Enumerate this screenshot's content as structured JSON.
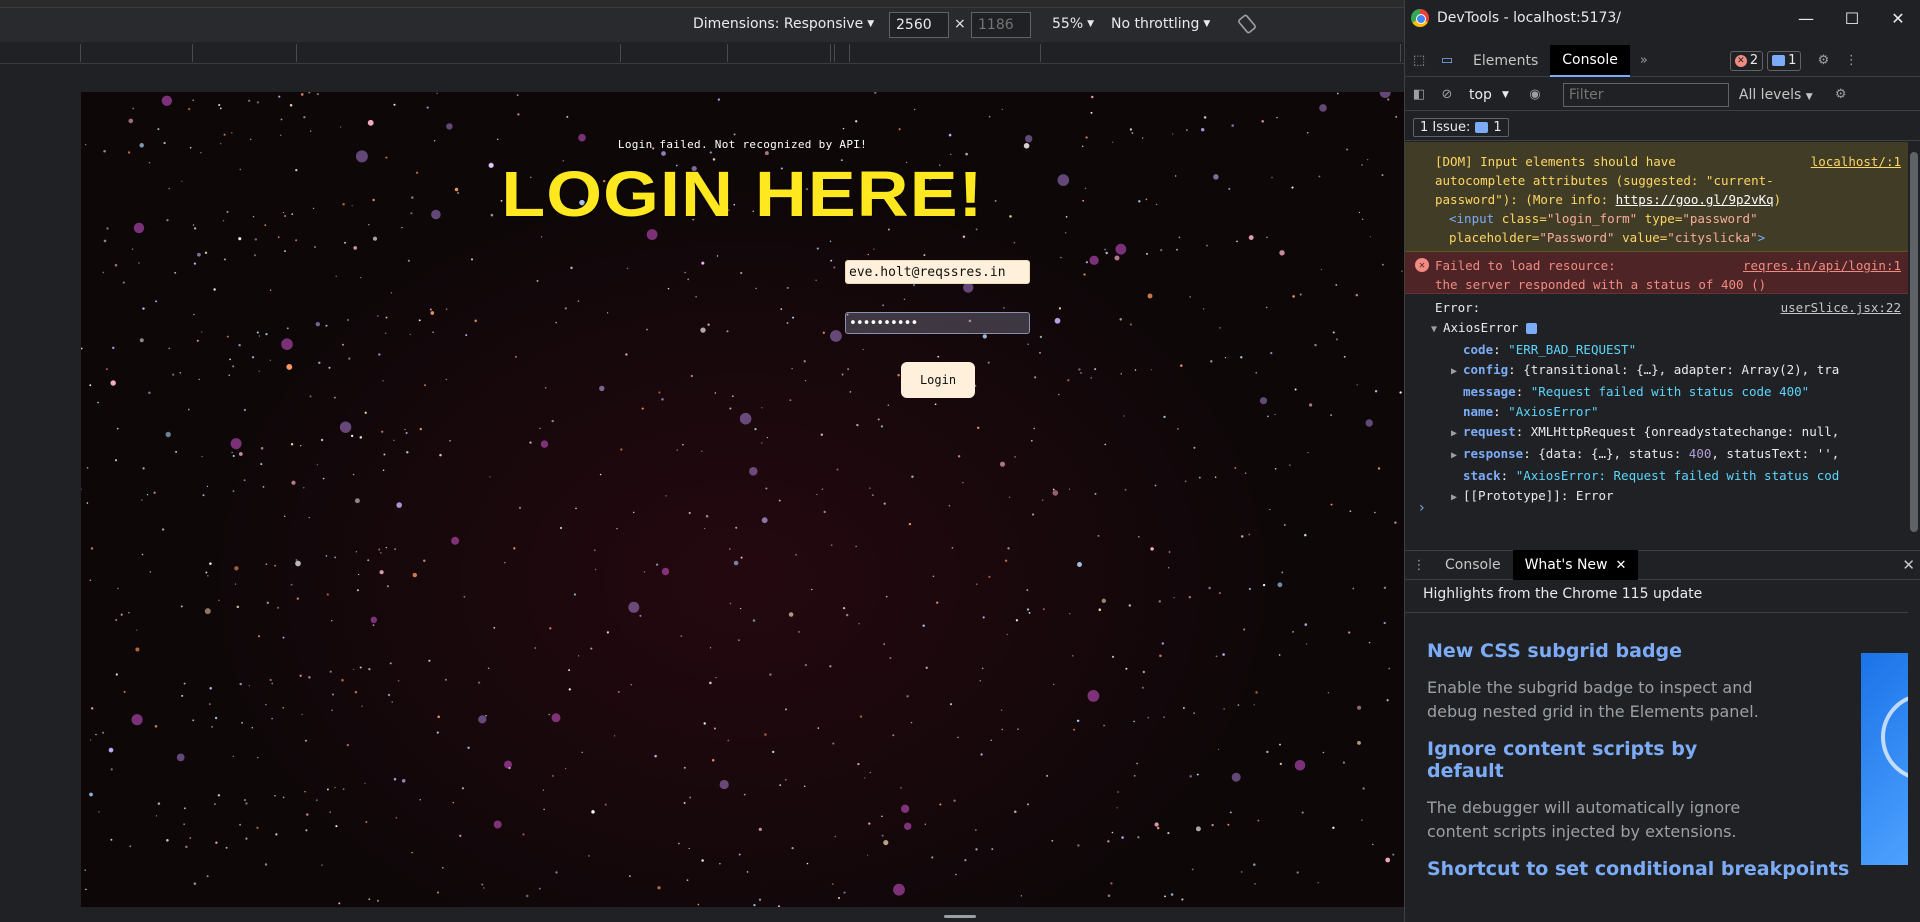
{
  "toolbar": {
    "dimensions_label": "Dimensions: Responsive",
    "width_value": "2560",
    "height_placeholder": "1186",
    "times": "×",
    "zoom": "55%",
    "throttling": "No throttling"
  },
  "page": {
    "fail_message": "Login failed. Not recognized by API!",
    "title": "LOGIN HERE!",
    "email_value": "eve.holt@reqssres.in",
    "password_value": "cityslicka",
    "login_button": "Login"
  },
  "devtools": {
    "window_title": "DevTools - localhost:5173/",
    "tabs": [
      "Elements",
      "Console"
    ],
    "error_count": "2",
    "message_count": "1",
    "context": "top",
    "filter_placeholder": "Filter",
    "levels": "All levels",
    "issues_label": "1 Issue:",
    "issues_count": "1",
    "warning": {
      "text1": "[DOM] Input elements should have",
      "text2": "autocomplete attributes (suggested: \"current-",
      "text3": "password\"): (More info: ",
      "link": "https://goo.gl/9p2vKq",
      "text3_end": ")",
      "code_tag_open": "<input",
      "code_class_attr": "class",
      "code_class_val": "\"login_form\"",
      "code_type_attr": "type",
      "code_type_val": "\"password\"",
      "code_ph_attr": "placeholder",
      "code_ph_val": "\"Password\"",
      "code_val_attr": "value",
      "code_val_val": "\"cityslicka\"",
      "code_close": ">",
      "source": "localhost/:1"
    },
    "error": {
      "line1": "Failed to load resource:",
      "line2": "the server responded with a status of 400 ()",
      "source": "reqres.in/api/login:1"
    },
    "axios": {
      "label": "Error:",
      "source": "userSlice.jsx:22",
      "name": "AxiosError",
      "code_key": "code",
      "code_val": "\"ERR_BAD_REQUEST\"",
      "config_key": "config",
      "config_val": "{transitional: {…}, adapter: Array(2), tra",
      "message_key": "message",
      "message_val": "\"Request failed with status code 400\"",
      "name_key": "name",
      "name_val": "\"AxiosError\"",
      "request_key": "request",
      "request_val": "XMLHttpRequest {onreadystatechange: null,",
      "response_key": "response",
      "response_val_a": "{data: {…}, status: ",
      "response_status": "400",
      "response_val_b": ", statusText: '',",
      "stack_key": "stack",
      "stack_val": "\"AxiosError: Request failed with status cod",
      "proto": "[[Prototype]]",
      "proto_val": "Error"
    },
    "prompt": "›",
    "drawer_tabs": [
      "Console",
      "What's New"
    ],
    "highlights": "Highlights from the Chrome 115 update",
    "whats_new": [
      {
        "heading": "New CSS subgrid badge",
        "body": "Enable the subgrid badge to inspect and debug nested grid in the Elements panel."
      },
      {
        "heading": "Ignore content scripts by default",
        "body": "The debugger will automatically ignore content scripts injected by extensions."
      },
      {
        "heading": "Shortcut to set conditional breakpoints",
        "body": ""
      }
    ]
  },
  "colors": {
    "title_yellow": "#ffe81f",
    "input_bg": "#fff0dc",
    "devtools_bg": "#202124",
    "link_blue": "#7cacf8"
  }
}
